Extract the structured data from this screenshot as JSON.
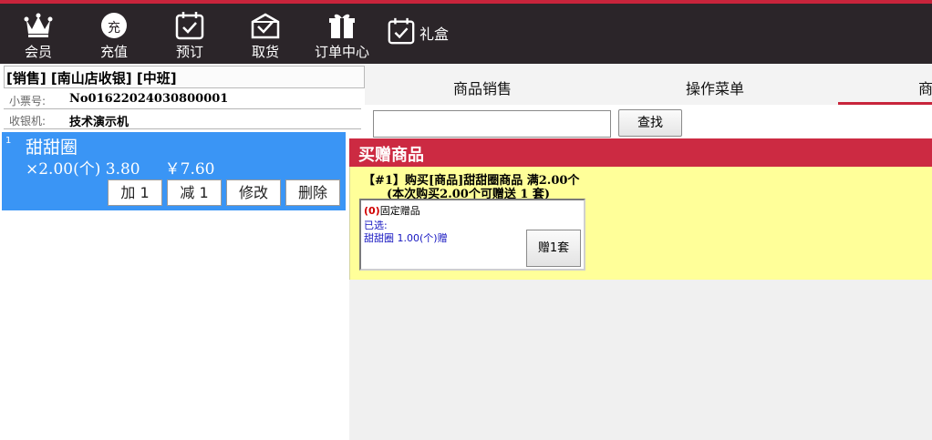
{
  "toolbar": {
    "items": [
      {
        "label": "会员",
        "icon": "crown-icon"
      },
      {
        "label": "充值",
        "icon": "recharge-icon",
        "glyph": "充"
      },
      {
        "label": "预订",
        "icon": "calendar-check-icon"
      },
      {
        "label": "取货",
        "icon": "pickup-box-icon"
      },
      {
        "label": "订单中心",
        "icon": "gift-order-icon"
      },
      {
        "label": "礼盒",
        "icon": "gift-box-calendar-icon"
      }
    ]
  },
  "left_panel": {
    "mode_line": "[销售] [南山店收银] [中班]",
    "receipt_label": "小票号:",
    "receipt_value": "No01622024030800001",
    "cashier_label": "收银机:",
    "cashier_value": "技术演示机"
  },
  "cart": {
    "items": [
      {
        "index": "1",
        "name": "甜甜圈",
        "detail": "×2.00(个) 3.80     ￥7.60",
        "buttons": {
          "add": "加 1",
          "sub": "减 1",
          "edit": "修改",
          "delete": "删除"
        }
      }
    ]
  },
  "tabs": {
    "items": [
      "商品销售",
      "操作菜单",
      "商"
    ]
  },
  "search": {
    "value": "",
    "button_label": "查找"
  },
  "gift_panel": {
    "title": "买赠商品",
    "promo_line1": "【#1】购买[商品]甜甜圈商品 满2.00个",
    "promo_line2": "(本次购买2.00个可赠送 1 套)",
    "box": {
      "count": "(0)",
      "category": "固定赠品",
      "selected_label": "已选:",
      "selected_item": "甜甜圈 1.00(个)赠",
      "button_label": "赠1套"
    }
  },
  "colors": {
    "topbar": "#2b2529",
    "accent": "#c8243b",
    "cart_highlight": "#3a95f5",
    "gift_body": "#ffff99"
  }
}
